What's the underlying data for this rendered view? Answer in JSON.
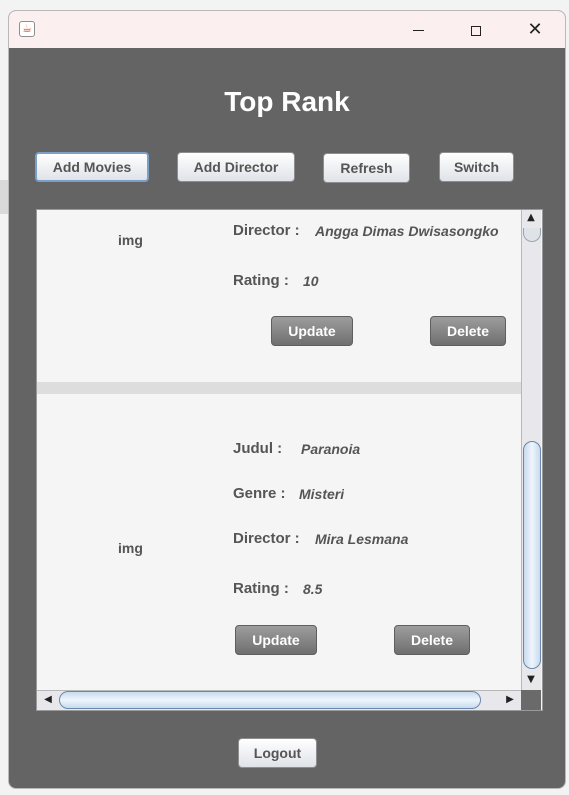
{
  "window": {
    "title_icon": "java-icon",
    "controls": {
      "minimize": "minimize-icon",
      "maximize": "maximize-icon",
      "close": "close-icon"
    }
  },
  "page": {
    "title": "Top Rank"
  },
  "toolbar": {
    "add_movies": "Add Movies",
    "add_director": "Add Director",
    "refresh": "Refresh",
    "switch": "Switch"
  },
  "movies": [
    {
      "img": "img",
      "director_label": "Director :",
      "director": "Angga Dimas Dwisasongko",
      "rating_label": "Rating :",
      "rating": "10",
      "update": "Update",
      "delete": "Delete"
    },
    {
      "img": "img",
      "judul_label": "Judul :",
      "judul": "Paranoia",
      "genre_label": "Genre :",
      "genre": "Misteri",
      "director_label": "Director :",
      "director": "Mira Lesmana",
      "rating_label": "Rating :",
      "rating": "8.5",
      "update": "Update",
      "delete": "Delete"
    }
  ],
  "footer": {
    "logout": "Logout"
  },
  "colors": {
    "window_bg": "#646464",
    "panel_bg": "#f5f5f5",
    "title_text": "#ffffff"
  }
}
